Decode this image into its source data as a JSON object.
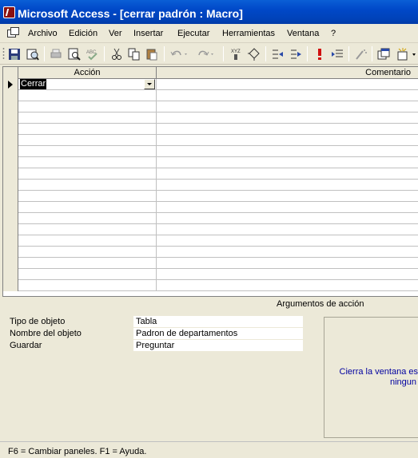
{
  "window": {
    "title": "Microsoft Access - [cerrar padrón : Macro]"
  },
  "menu": {
    "items": [
      {
        "label": "Archivo"
      },
      {
        "label": "Edición"
      },
      {
        "label": "Ver"
      },
      {
        "label": "Insertar"
      },
      {
        "label": "Ejecutar"
      },
      {
        "label": "Herramientas"
      },
      {
        "label": "Ventana"
      },
      {
        "label": "?"
      }
    ]
  },
  "toolbar": {
    "buttons": [
      "save-icon",
      "print-preview-design-icon",
      "print-icon",
      "print-preview-icon",
      "spelling-icon",
      "cut-icon",
      "copy-icon",
      "paste-icon",
      "undo-icon",
      "redo-icon",
      "macro-names-icon",
      "conditions-icon",
      "insert-rows-icon",
      "delete-rows-icon",
      "run-icon",
      "single-step-icon",
      "build-icon",
      "database-window-icon",
      "new-object-icon"
    ]
  },
  "grid": {
    "columns": {
      "action": "Acción",
      "comment": "Comentario"
    },
    "rows": [
      {
        "action": "Cerrar",
        "comment": ""
      }
    ]
  },
  "arguments": {
    "title": "Argumentos de acción",
    "fields": [
      {
        "label": "Tipo de objeto",
        "value": "Tabla"
      },
      {
        "label": "Nombre del objeto",
        "value": "Padron de departamentos"
      },
      {
        "label": "Guardar",
        "value": "Preguntar"
      }
    ],
    "help_lines": [
      "Cierra la ventana es",
      "ningun"
    ]
  },
  "status": {
    "text": "F6 = Cambiar paneles.  F1 = Ayuda."
  },
  "colors": {
    "titlebar": "#0048c8",
    "help_text": "#0000a0",
    "chrome": "#ece9d8"
  }
}
